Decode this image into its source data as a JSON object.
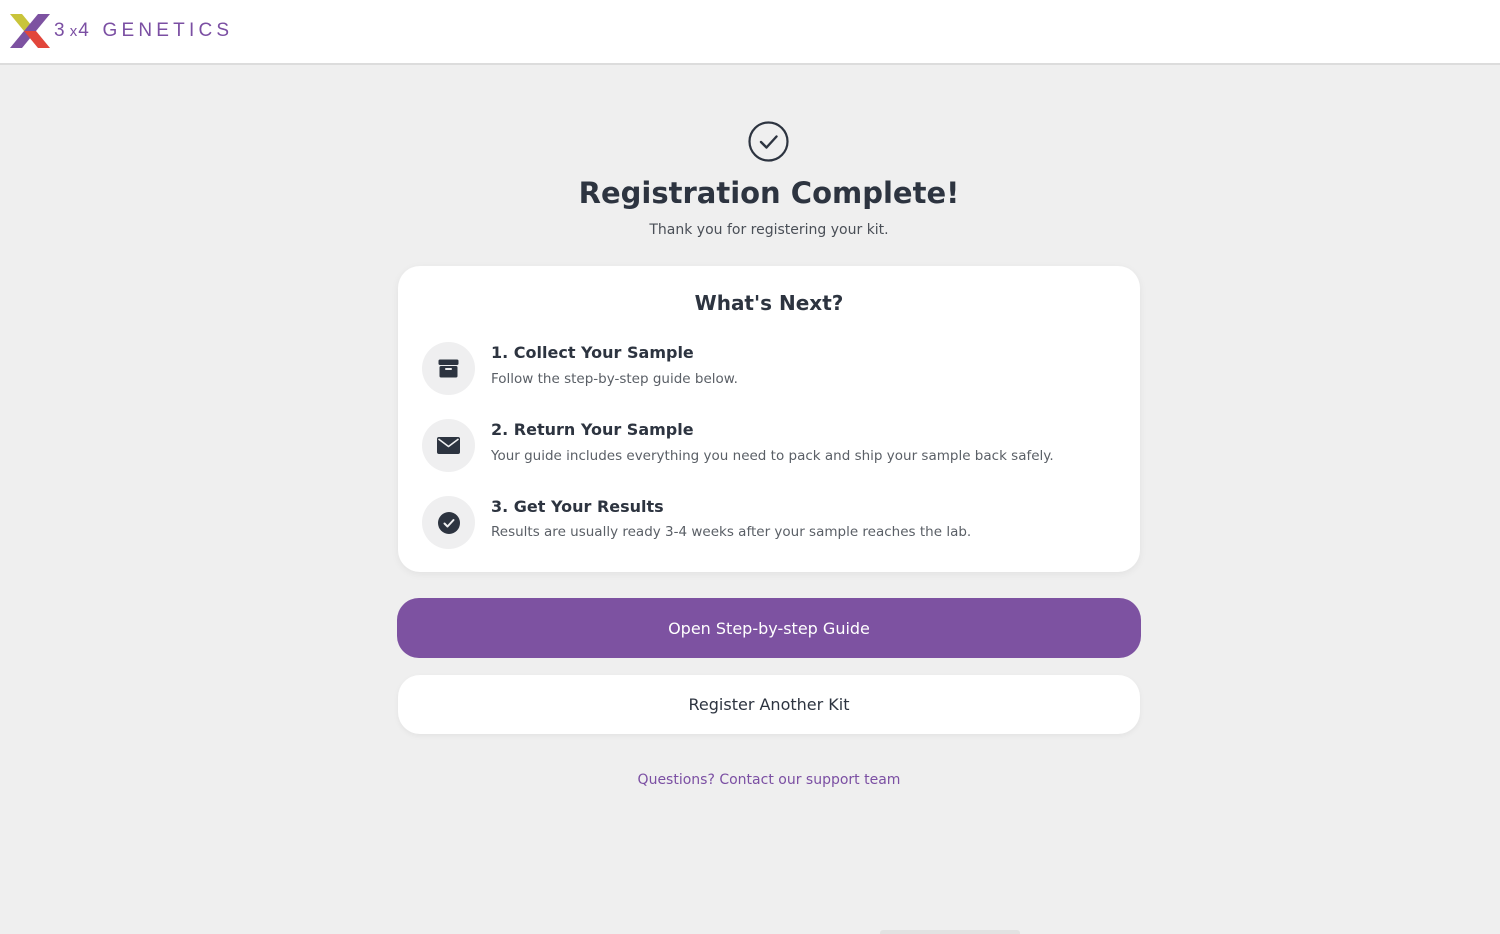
{
  "header": {
    "logo_text": "3X4 GENETICS",
    "logo_prefix": "3",
    "logo_x": "x",
    "logo_suffix": "4 GENETICS"
  },
  "confirmation": {
    "icon": "check-circle-icon",
    "title": "Registration Complete!",
    "subtitle": "Thank you for registering your kit."
  },
  "next_steps": {
    "title": "What's Next?",
    "steps": [
      {
        "icon": "box-icon",
        "title": "1. Collect Your Sample",
        "description": "Follow the step-by-step guide below."
      },
      {
        "icon": "envelope-icon",
        "title": "2. Return Your Sample",
        "description": "Your guide includes everything you need to pack and ship your sample back safely."
      },
      {
        "icon": "check-circle-filled-icon",
        "title": "3. Get Your Results",
        "description": "Results are usually ready 3-4 weeks after your sample reaches the lab."
      }
    ]
  },
  "actions": {
    "primary_label": "Open Step-by-step Guide",
    "secondary_label": "Register Another Kit"
  },
  "footer": {
    "support_link": "Questions? Contact our support team"
  },
  "colors": {
    "brand_purple": "#7d52a1",
    "text_dark": "#2d3440",
    "background": "#efefef"
  }
}
